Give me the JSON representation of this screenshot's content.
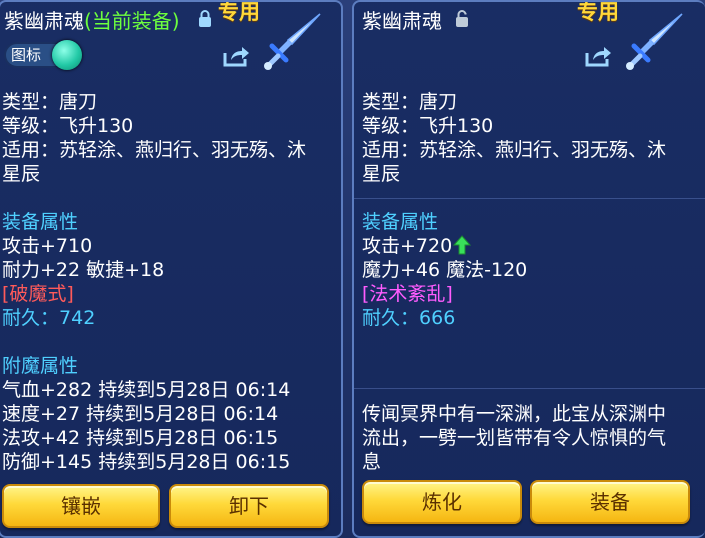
{
  "left_panel": {
    "item_name": "紫幽肃魂",
    "equipped_tag": "(当前装备)",
    "special_tag": "专用",
    "icon_toggle_label": "图标",
    "type_line": "类型：唐刀",
    "level_line": "等级：飞升130",
    "applies_line1": "适用：苏轻涂、燕归行、羽无殇、沐",
    "applies_line2": "星辰",
    "equip_attr_header": "装备属性",
    "attack": "攻击+710",
    "stats": "耐力+22 敏捷+18",
    "special_effect": "[破魔式]",
    "durability_label": "耐久：",
    "durability_value": "742",
    "enchant_header": "附魔属性",
    "enchants": [
      "气血+282 持续到5月28日 06:14",
      "速度+27 持续到5月28日 06:14",
      "法攻+42 持续到5月28日 06:15",
      "防御+145 持续到5月28日 06:15"
    ],
    "btn_inlay": "镶嵌",
    "btn_unequip": "卸下"
  },
  "right_panel": {
    "item_name": "紫幽肃魂",
    "special_tag": "专用",
    "type_line": "类型：唐刀",
    "level_line": "等级：飞升130",
    "applies_line1": "适用：苏轻涂、燕归行、羽无殇、沐",
    "applies_line2": "星辰",
    "equip_attr_header": "装备属性",
    "attack": "攻击+720",
    "stats": "魔力+46 魔法-120",
    "special_effect": "[法术紊乱]",
    "durability_label": "耐久：",
    "durability_value": "666",
    "desc_line1": "传闻冥界中有一深渊，此宝从深渊中",
    "desc_line2": "流出，一劈一划皆带有令人惊惧的气",
    "desc_line3": "息",
    "btn_refine": "炼化",
    "btn_equip": "装备"
  },
  "colors": {
    "equipped_tag": "#6dff3e",
    "special_tag": "#ffd83a",
    "section_header": "#4fd0ff",
    "special_effect_left": "#ff5a5a",
    "special_effect_right": "#ff5cff",
    "upgrade_arrow": "#39e05a",
    "button": "#ffd93a"
  },
  "icons": [
    "lock-closed-icon",
    "lock-open-icon",
    "share-icon",
    "sword-item-icon",
    "upgrade-arrow-icon"
  ]
}
